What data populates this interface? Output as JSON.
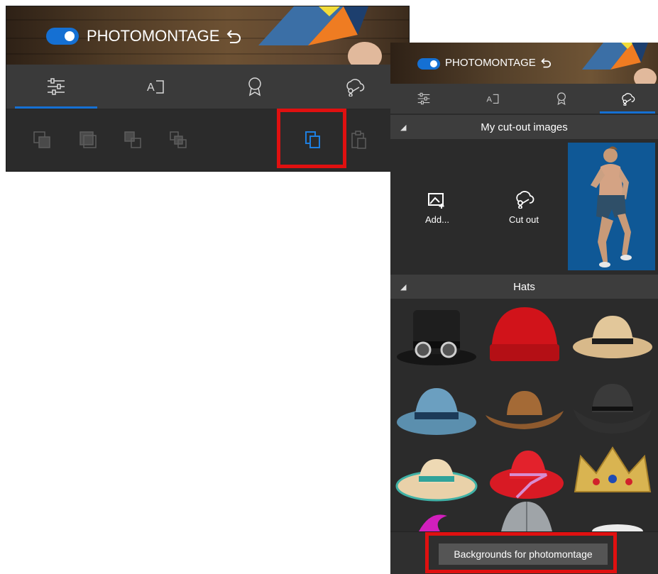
{
  "toolbar_view": {
    "banner": {
      "toggle_on": true,
      "title": "PHOTOMONTAGE"
    },
    "tabs": [
      {
        "name": "adjustments",
        "icon": "sliders-icon",
        "active": true
      },
      {
        "name": "text",
        "icon": "text-box-icon",
        "active": false
      },
      {
        "name": "stickers",
        "icon": "ribbon-badge-icon",
        "active": false
      },
      {
        "name": "photomontage",
        "icon": "cloud-scissors-icon",
        "active": false
      }
    ],
    "tools": [
      {
        "icon": "bring-forward-icon",
        "enabled": false
      },
      {
        "icon": "send-backward-icon",
        "enabled": false
      },
      {
        "icon": "bring-to-front-icon",
        "enabled": false
      },
      {
        "icon": "send-to-back-icon",
        "enabled": false
      },
      {
        "icon": "copy-icon",
        "enabled": true,
        "highlighted": true
      },
      {
        "icon": "paste-icon",
        "enabled": false
      }
    ]
  },
  "side_panel": {
    "banner": {
      "toggle_on": true,
      "title": "PHOTOMONTAGE"
    },
    "active_tab": "photomontage",
    "cutout_section": {
      "title": "My cut-out images",
      "add_label": "Add...",
      "cutout_label": "Cut out",
      "items": [
        "running-man-cutout"
      ]
    },
    "hats_section": {
      "title": "Hats",
      "items": [
        "black-top-hat-with-goggles",
        "red-beanie",
        "straw-cowboy-hat",
        "blue-fedora",
        "brown-cowboy-hat",
        "black-cowboy-hat",
        "teal-sun-hat",
        "red-floppy-hat",
        "golden-crown"
      ]
    },
    "footer_button": "Backgrounds for photomontage"
  },
  "colors": {
    "accent": "#1570d3",
    "highlight_box": "#e01010",
    "panel_bg": "#2b2b2b",
    "section_header_bg": "#3d3d3d",
    "footer_button_bg": "#555555"
  }
}
